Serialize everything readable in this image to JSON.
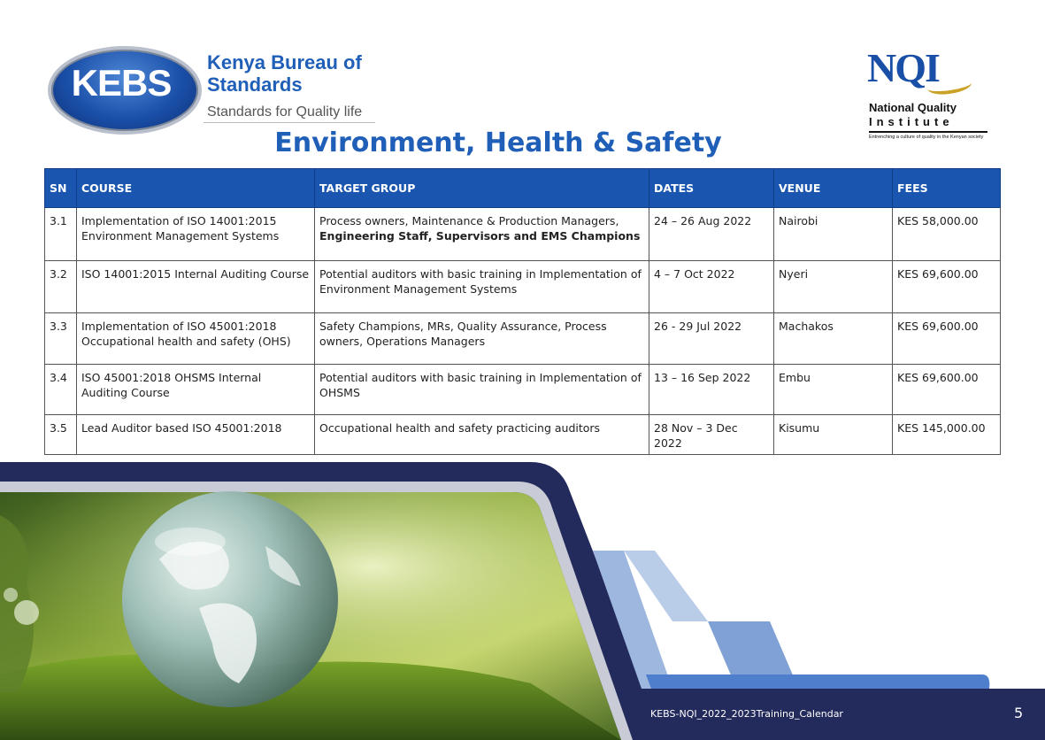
{
  "kebs": {
    "oval_text": "KEBS",
    "name": "Kenya Bureau of Standards",
    "tagline": "Standards for Quality life"
  },
  "nqi": {
    "mark": "NQI",
    "line1": "National Quality",
    "line2": "Institute",
    "slogan": "Entrenching a culture of quality in the Kenyan society"
  },
  "title": "Environment, Health & Safety",
  "table": {
    "headers": [
      "SN",
      "COURSE",
      "TARGET GROUP",
      "DATES",
      "VENUE",
      "FEES"
    ],
    "rows": [
      {
        "sn": "3.1",
        "course": "Implementation of ISO 14001:2015 Environment Management Systems",
        "target": "Process owners, Maintenance & Production Managers,",
        "target_bold": "Engineering Staff, Supervisors and EMS Champions",
        "dates": "24 – 26 Aug 2022",
        "venue": "Nairobi",
        "fees": "KES 58,000.00"
      },
      {
        "sn": "3.2",
        "course": "ISO 14001:2015 Internal Auditing Course",
        "target": "Potential auditors with basic training in Implementation of Environment Management Systems",
        "dates": "4 – 7 Oct 2022",
        "venue": "Nyeri",
        "fees": "KES 69,600.00"
      },
      {
        "sn": "3.3",
        "course": "Implementation of ISO 45001:2018 Occupational health and safety (OHS)",
        "target": "Safety Champions, MRs, Quality Assurance, Process owners, Operations Managers",
        "dates": "26 - 29 Jul 2022",
        "venue": "Machakos",
        "fees": "KES 69,600.00"
      },
      {
        "sn": "3.4",
        "course": "ISO 45001:2018 OHSMS Internal Auditing Course",
        "target": "Potential auditors with basic training in Implementation of OHSMS",
        "dates": "13 – 16 Sep 2022",
        "venue": "Embu",
        "fees": "KES 69,600.00"
      },
      {
        "sn": "3.5",
        "course": "Lead Auditor based ISO 45001:2018",
        "target": "Occupational health and safety practicing auditors",
        "dates": "28 Nov – 3 Dec 2022",
        "venue": "Kisumu",
        "fees": "KES 145,000.00"
      }
    ]
  },
  "footer": {
    "doc_name": "KEBS-NQI_2022_2023Training_Calendar",
    "page_number": "5"
  },
  "colors": {
    "brand_blue": "#1f5fb8",
    "header_blue": "#1a56b0",
    "navy": "#232a5c"
  }
}
